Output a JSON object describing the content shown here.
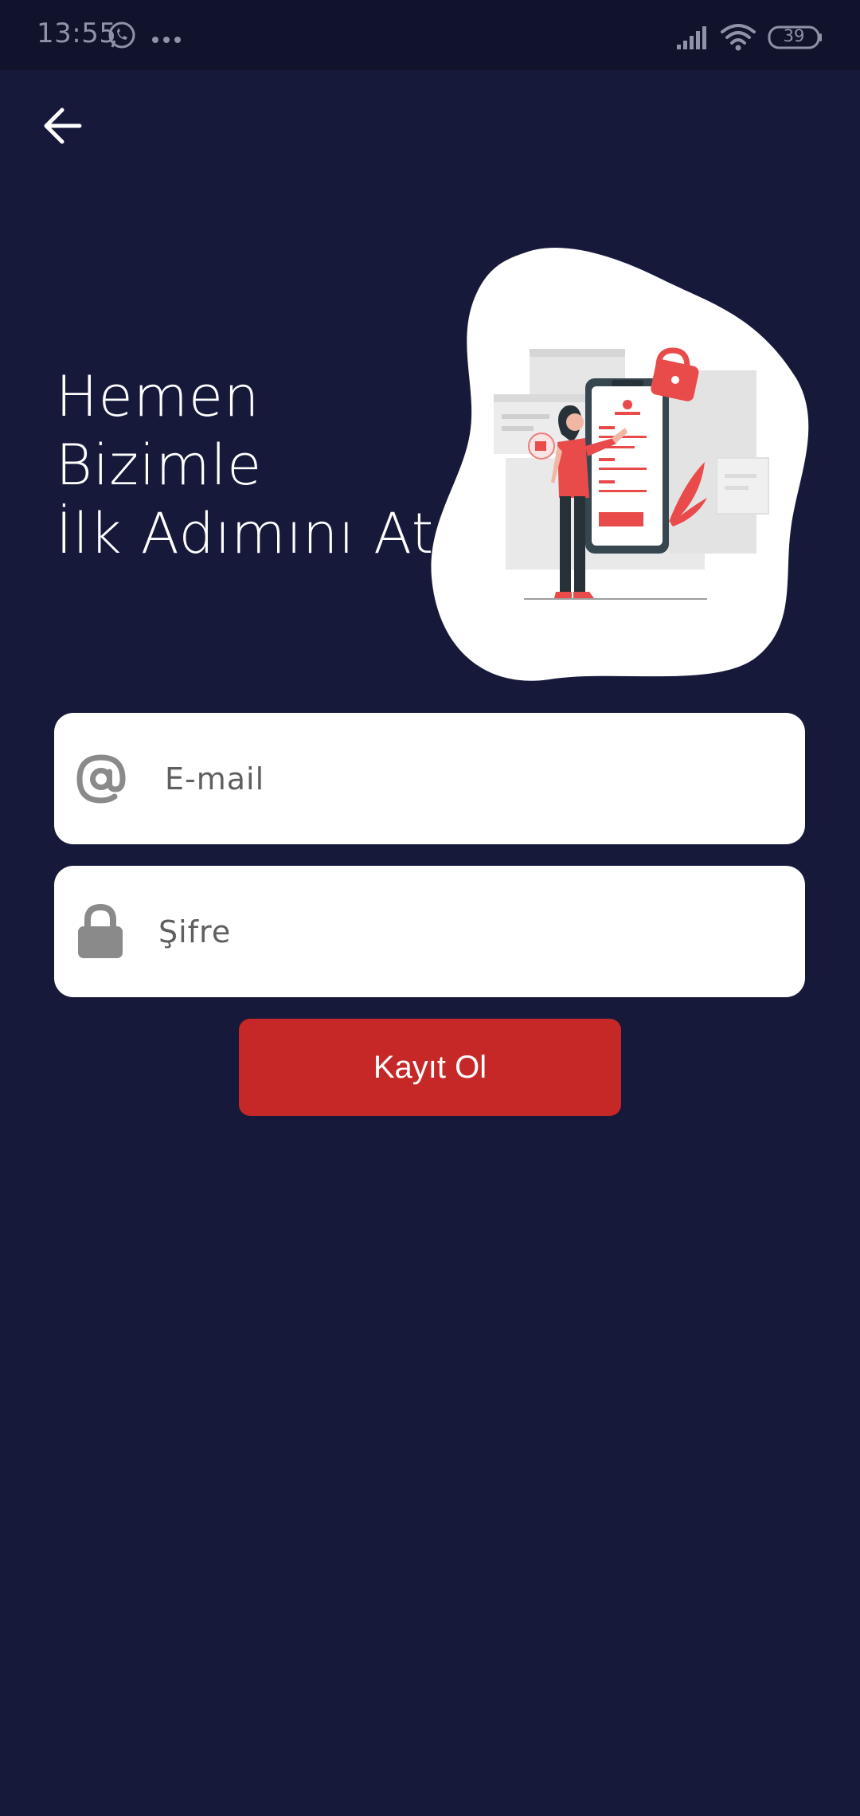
{
  "status_bar": {
    "time": "13:55",
    "battery": "39"
  },
  "headline": {
    "line1": "Hemen",
    "line2": "Bizimle",
    "line3": "İlk Adımını At"
  },
  "form": {
    "email_placeholder": "E-mail",
    "password_placeholder": "Şifre",
    "submit_label": "Kayıt Ol"
  },
  "colors": {
    "background": "#16193a",
    "status_bar": "#11132c",
    "accent": "#c62828",
    "field_background": "#ffffff",
    "icon_gray": "#8a8a8a"
  },
  "icons": {
    "back": "arrow-left-icon",
    "email": "at-sign-icon",
    "password": "lock-icon",
    "messaging": "whatsapp-icon",
    "more": "more-dots-icon",
    "signal": "signal-icon",
    "wifi": "wifi-icon",
    "battery": "battery-icon"
  }
}
